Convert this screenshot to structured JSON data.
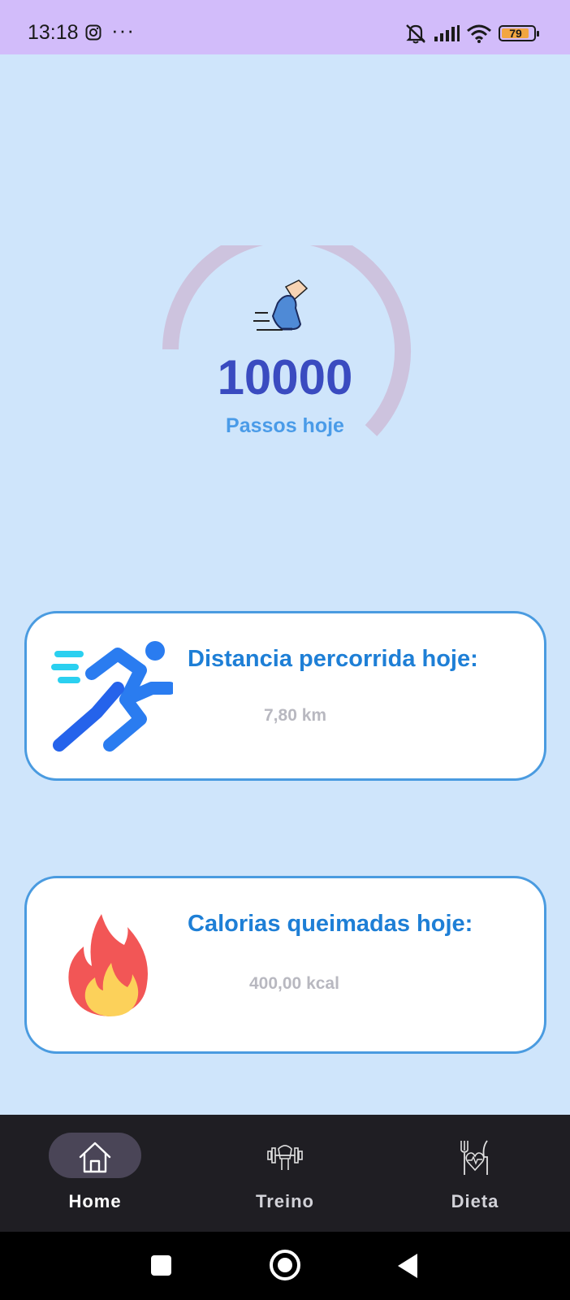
{
  "status_bar": {
    "time": "13:18",
    "overflow": "···",
    "battery_level": "79",
    "icons": [
      "instagram-icon",
      "mute-bell-icon",
      "signal-icon",
      "wifi-icon",
      "battery-icon"
    ]
  },
  "steps": {
    "value": "10000",
    "label": "Passos hoje",
    "icon": "running-shoe-icon"
  },
  "distance_card": {
    "title": "Distancia percorrida hoje:",
    "value": "7,80 km",
    "icon": "runner-icon"
  },
  "calories_card": {
    "title": "Calorias queimadas hoje:",
    "value": "400,00 kcal",
    "icon": "flame-icon"
  },
  "bottom_nav": {
    "items": [
      {
        "label": "Home",
        "icon": "home-icon",
        "active": true
      },
      {
        "label": "Treino",
        "icon": "dumbbell-icon",
        "active": false
      },
      {
        "label": "Dieta",
        "icon": "diet-heart-icon",
        "active": false
      }
    ]
  },
  "colors": {
    "background": "#cfe5fb",
    "status_bar": "#d2bcfa",
    "accent_blue": "#1e7fd6",
    "steps_value": "#3a4bc0",
    "gauge_track": "#cdc3de",
    "nav_background": "#1f1e23"
  }
}
